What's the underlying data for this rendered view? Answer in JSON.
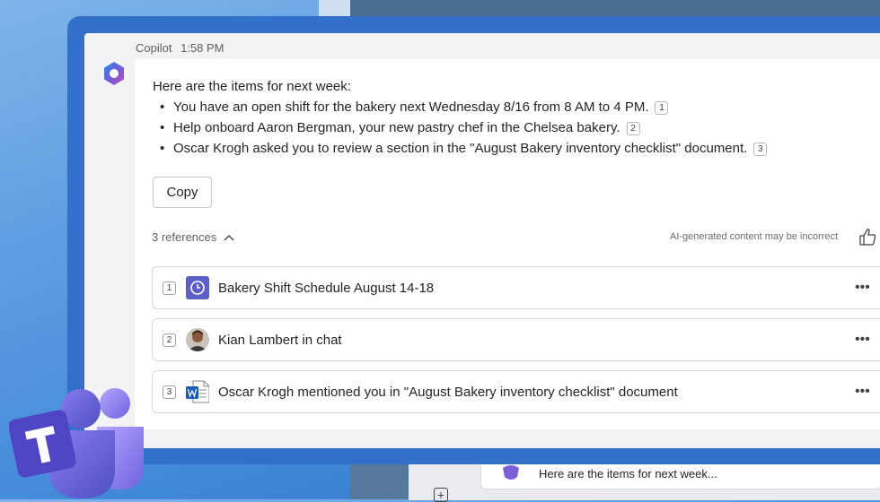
{
  "header": {
    "sender": "Copilot",
    "time": "1:58 PM"
  },
  "message": {
    "intro": "Here are the items for next week:",
    "items": [
      {
        "text": "You have an open shift for the bakery next Wednesday 8/16 from 8 AM to 4 PM.",
        "cite": "1"
      },
      {
        "text": "Help onboard Aaron Bergman, your new pastry chef in the Chelsea bakery.",
        "cite": "2"
      },
      {
        "text": "Oscar Krogh asked you to review a section in the \"August Bakery inventory checklist\" document.",
        "cite": "3"
      }
    ]
  },
  "actions": {
    "copy_label": "Copy"
  },
  "references": {
    "toggle_label": "3 references",
    "disclaimer": "AI-generated content may be incorrect",
    "items": [
      {
        "num": "1",
        "title": "Bakery Shift Schedule August 14-18",
        "icon": "calendar-schedule-icon"
      },
      {
        "num": "2",
        "title": "Kian Lambert in chat",
        "icon": "person-avatar"
      },
      {
        "num": "3",
        "title": "Oscar Krogh mentioned you in \"August Bakery inventory checklist\" document",
        "icon": "word-document-icon"
      }
    ]
  },
  "background_chat": {
    "preview": "Here are the items for next week..."
  },
  "colors": {
    "accent": "#3370c9",
    "calendar": "#5b5fc7",
    "word": "#185abd"
  }
}
